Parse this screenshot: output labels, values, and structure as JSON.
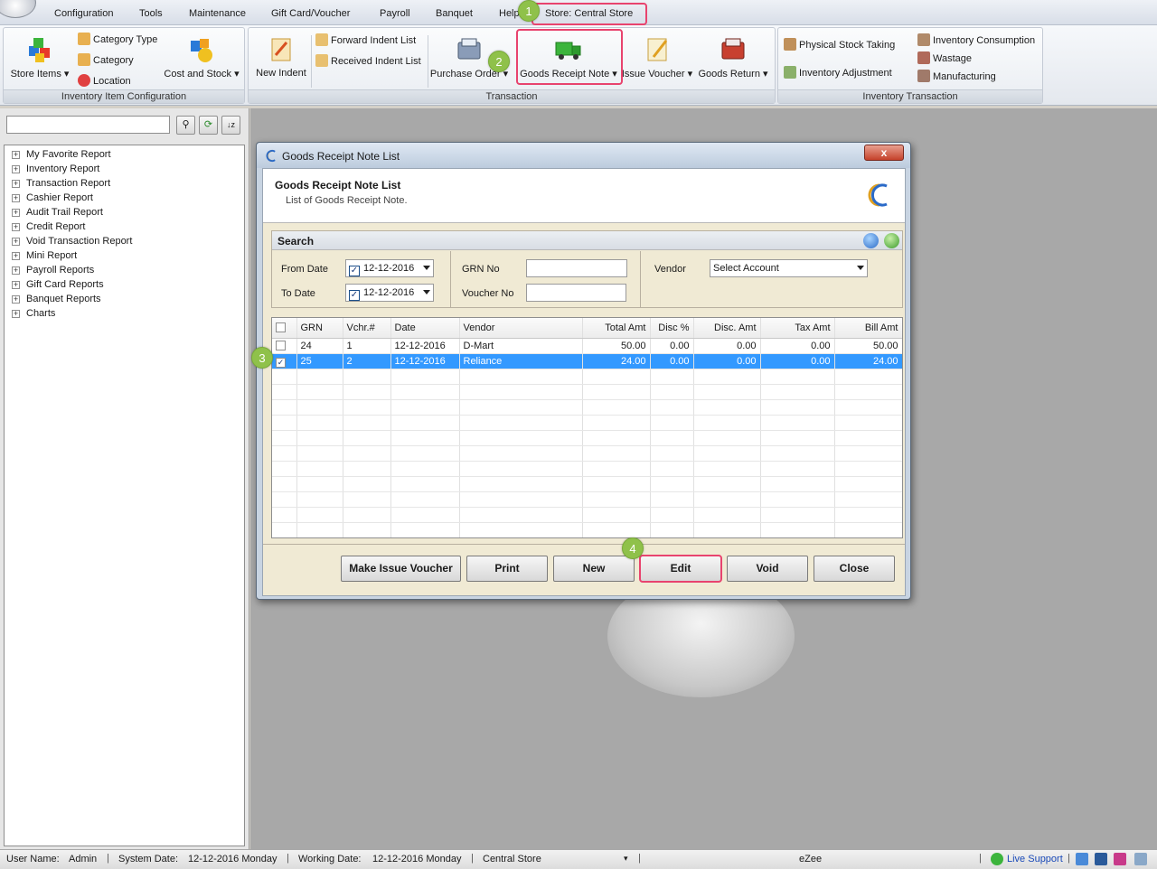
{
  "menu": {
    "items": [
      "Configuration",
      "Tools",
      "Maintenance",
      "Gift Card/Voucher",
      "Payroll",
      "Banquet",
      "Help",
      "Store: Central Store"
    ]
  },
  "ribbon": {
    "groups": {
      "inventory_item_configuration": "Inventory Item Configuration",
      "transaction": "Transaction",
      "inventory_transaction": "Inventory Transaction"
    },
    "store_items": "Store Items",
    "category_type": "Category Type",
    "category": "Category",
    "location": "Location",
    "cost_and_stock": "Cost and Stock",
    "new_indent": "New Indent",
    "forward_indent_list": "Forward Indent List",
    "received_indent_list": "Received Indent List",
    "purchase_order": "Purchase Order",
    "goods_receipt_note": "Goods Receipt Note",
    "issue_voucher": "Issue Voucher",
    "goods_return": "Goods Return",
    "physical_stock_taking": "Physical Stock Taking",
    "inventory_adjustment": "Inventory Adjustment",
    "inventory_consumption": "Inventory Consumption",
    "wastage": "Wastage",
    "manufacturing": "Manufacturing"
  },
  "badges": [
    "1",
    "2",
    "3",
    "4"
  ],
  "left_panel": {
    "search_value": "",
    "tree": [
      "My Favorite Report",
      "Inventory Report",
      "Transaction Report",
      "Cashier Report",
      "Audit Trail Report",
      "Credit Report",
      "Void Transaction Report",
      "Mini Report",
      "Payroll Reports",
      "Gift Card Reports",
      "Banquet Reports",
      "Charts"
    ]
  },
  "dialog": {
    "window_title": "Goods Receipt Note List",
    "header_title": "Goods Receipt Note List",
    "header_subtitle": "List of Goods Receipt Note.",
    "search": {
      "title": "Search",
      "from_date_label": "From Date",
      "from_date": "12-12-2016",
      "to_date_label": "To Date",
      "to_date": "12-12-2016",
      "grn_no_label": "GRN No",
      "grn_no": "",
      "voucher_no_label": "Voucher No",
      "voucher_no": "",
      "vendor_label": "Vendor",
      "vendor": "Select Account"
    },
    "grid": {
      "columns": [
        "GRN",
        "Vchr.#",
        "Date",
        "Vendor",
        "Total Amt",
        "Disc %",
        "Disc. Amt",
        "Tax Amt",
        "Bill Amt"
      ],
      "rows": [
        {
          "checked": false,
          "selected": false,
          "cells": [
            "24",
            "1",
            "12-12-2016",
            "D-Mart",
            "50.00",
            "0.00",
            "0.00",
            "0.00",
            "50.00"
          ]
        },
        {
          "checked": true,
          "selected": true,
          "cells": [
            "25",
            "2",
            "12-12-2016",
            "Reliance",
            "24.00",
            "0.00",
            "0.00",
            "0.00",
            "24.00"
          ]
        }
      ]
    },
    "buttons": {
      "make_issue_voucher": "Make Issue Voucher",
      "print": "Print",
      "new": "New",
      "edit": "Edit",
      "void": "Void",
      "close": "Close"
    },
    "close_glyph": "x"
  },
  "statusbar": {
    "user_name_label": "User Name:",
    "user_name": "Admin",
    "system_date_label": "System Date:",
    "system_date": "12-12-2016 Monday",
    "working_date_label": "Working Date:",
    "working_date": "12-12-2016 Monday",
    "store": "Central Store",
    "brand": "eZee",
    "live_support": "Live Support"
  },
  "colors": {
    "highlight": "#e8436e",
    "badge": "#8fc14a",
    "selection": "#3399ff"
  }
}
